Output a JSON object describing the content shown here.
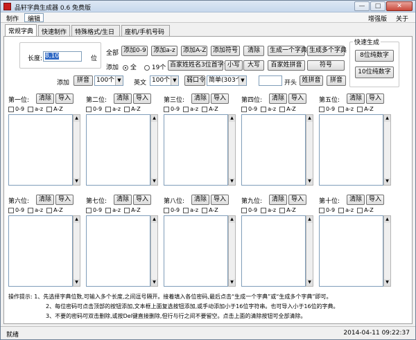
{
  "window": {
    "title": "品轩字典生成器 0.6 免费版",
    "min": "—",
    "max": "□",
    "close": "✕"
  },
  "menu": {
    "items": [
      "制作",
      "编辑"
    ],
    "right": [
      "增强版",
      "关于"
    ]
  },
  "tabs": [
    "常规字典",
    "快速制作",
    "特殊格式/生日",
    "座机/手机号码"
  ],
  "length": {
    "label": "长度:",
    "value": "8,10",
    "unit": "位"
  },
  "all": {
    "label": "全部",
    "buttons": [
      "添加0-9",
      "添加a-z",
      "添加A-Z",
      "添加符号",
      "清除",
      "生成一个字典",
      "生成多个字典"
    ]
  },
  "add_row": {
    "label": "添加",
    "radio_all": "全",
    "radio_19": "19个",
    "buttons": [
      "百家姓姓名3位首字母",
      "小写",
      "大写",
      "百家姓拼音",
      "符号"
    ]
  },
  "row3": {
    "add_label": "添加",
    "pinyin_btn": "拼音",
    "select1": "100个",
    "english_label": "英文",
    "select2": "100个",
    "weak_btn": "弱口令",
    "select3": "简单(303个)",
    "open_label": "开头",
    "surname_pinyin_btn": "姓拼音",
    "pinyin_btn2": "拼音"
  },
  "quick": {
    "title": "快速生成",
    "buttons": [
      "8位纯数字",
      "10位纯数字"
    ]
  },
  "slots": [
    {
      "title": "第一位:"
    },
    {
      "title": "第二位:"
    },
    {
      "title": "第三位:"
    },
    {
      "title": "第四位:"
    },
    {
      "title": "第五位:"
    },
    {
      "title": "第六位:"
    },
    {
      "title": "第七位:"
    },
    {
      "title": "第八位:"
    },
    {
      "title": "第九位:"
    },
    {
      "title": "第十位:"
    }
  ],
  "slot_labels": {
    "clear": "清除",
    "import": "导入",
    "cb1": "0-9",
    "cb2": "a-z",
    "cb3": "A-Z"
  },
  "tips": [
    "操作提示: 1、先选择字典位数,可输入多个长度,之间逗号隔开。接着填入各位密码,最后点击“生成一个字典”或“生成多个字典”即可。",
    "2、每位密码可点击顶部的按钮添加,文本框上面复选按钮添加,或手动添加小于16位字符串。也可导入小于16位的字典。",
    "3、不要的密码可双击删除,或按Del键直接删除,但行与行之间不要留空。点击上面的清除按钮可全部清除。"
  ],
  "status": {
    "left": "就绪",
    "right": "2014-04-11 09:22:37"
  }
}
